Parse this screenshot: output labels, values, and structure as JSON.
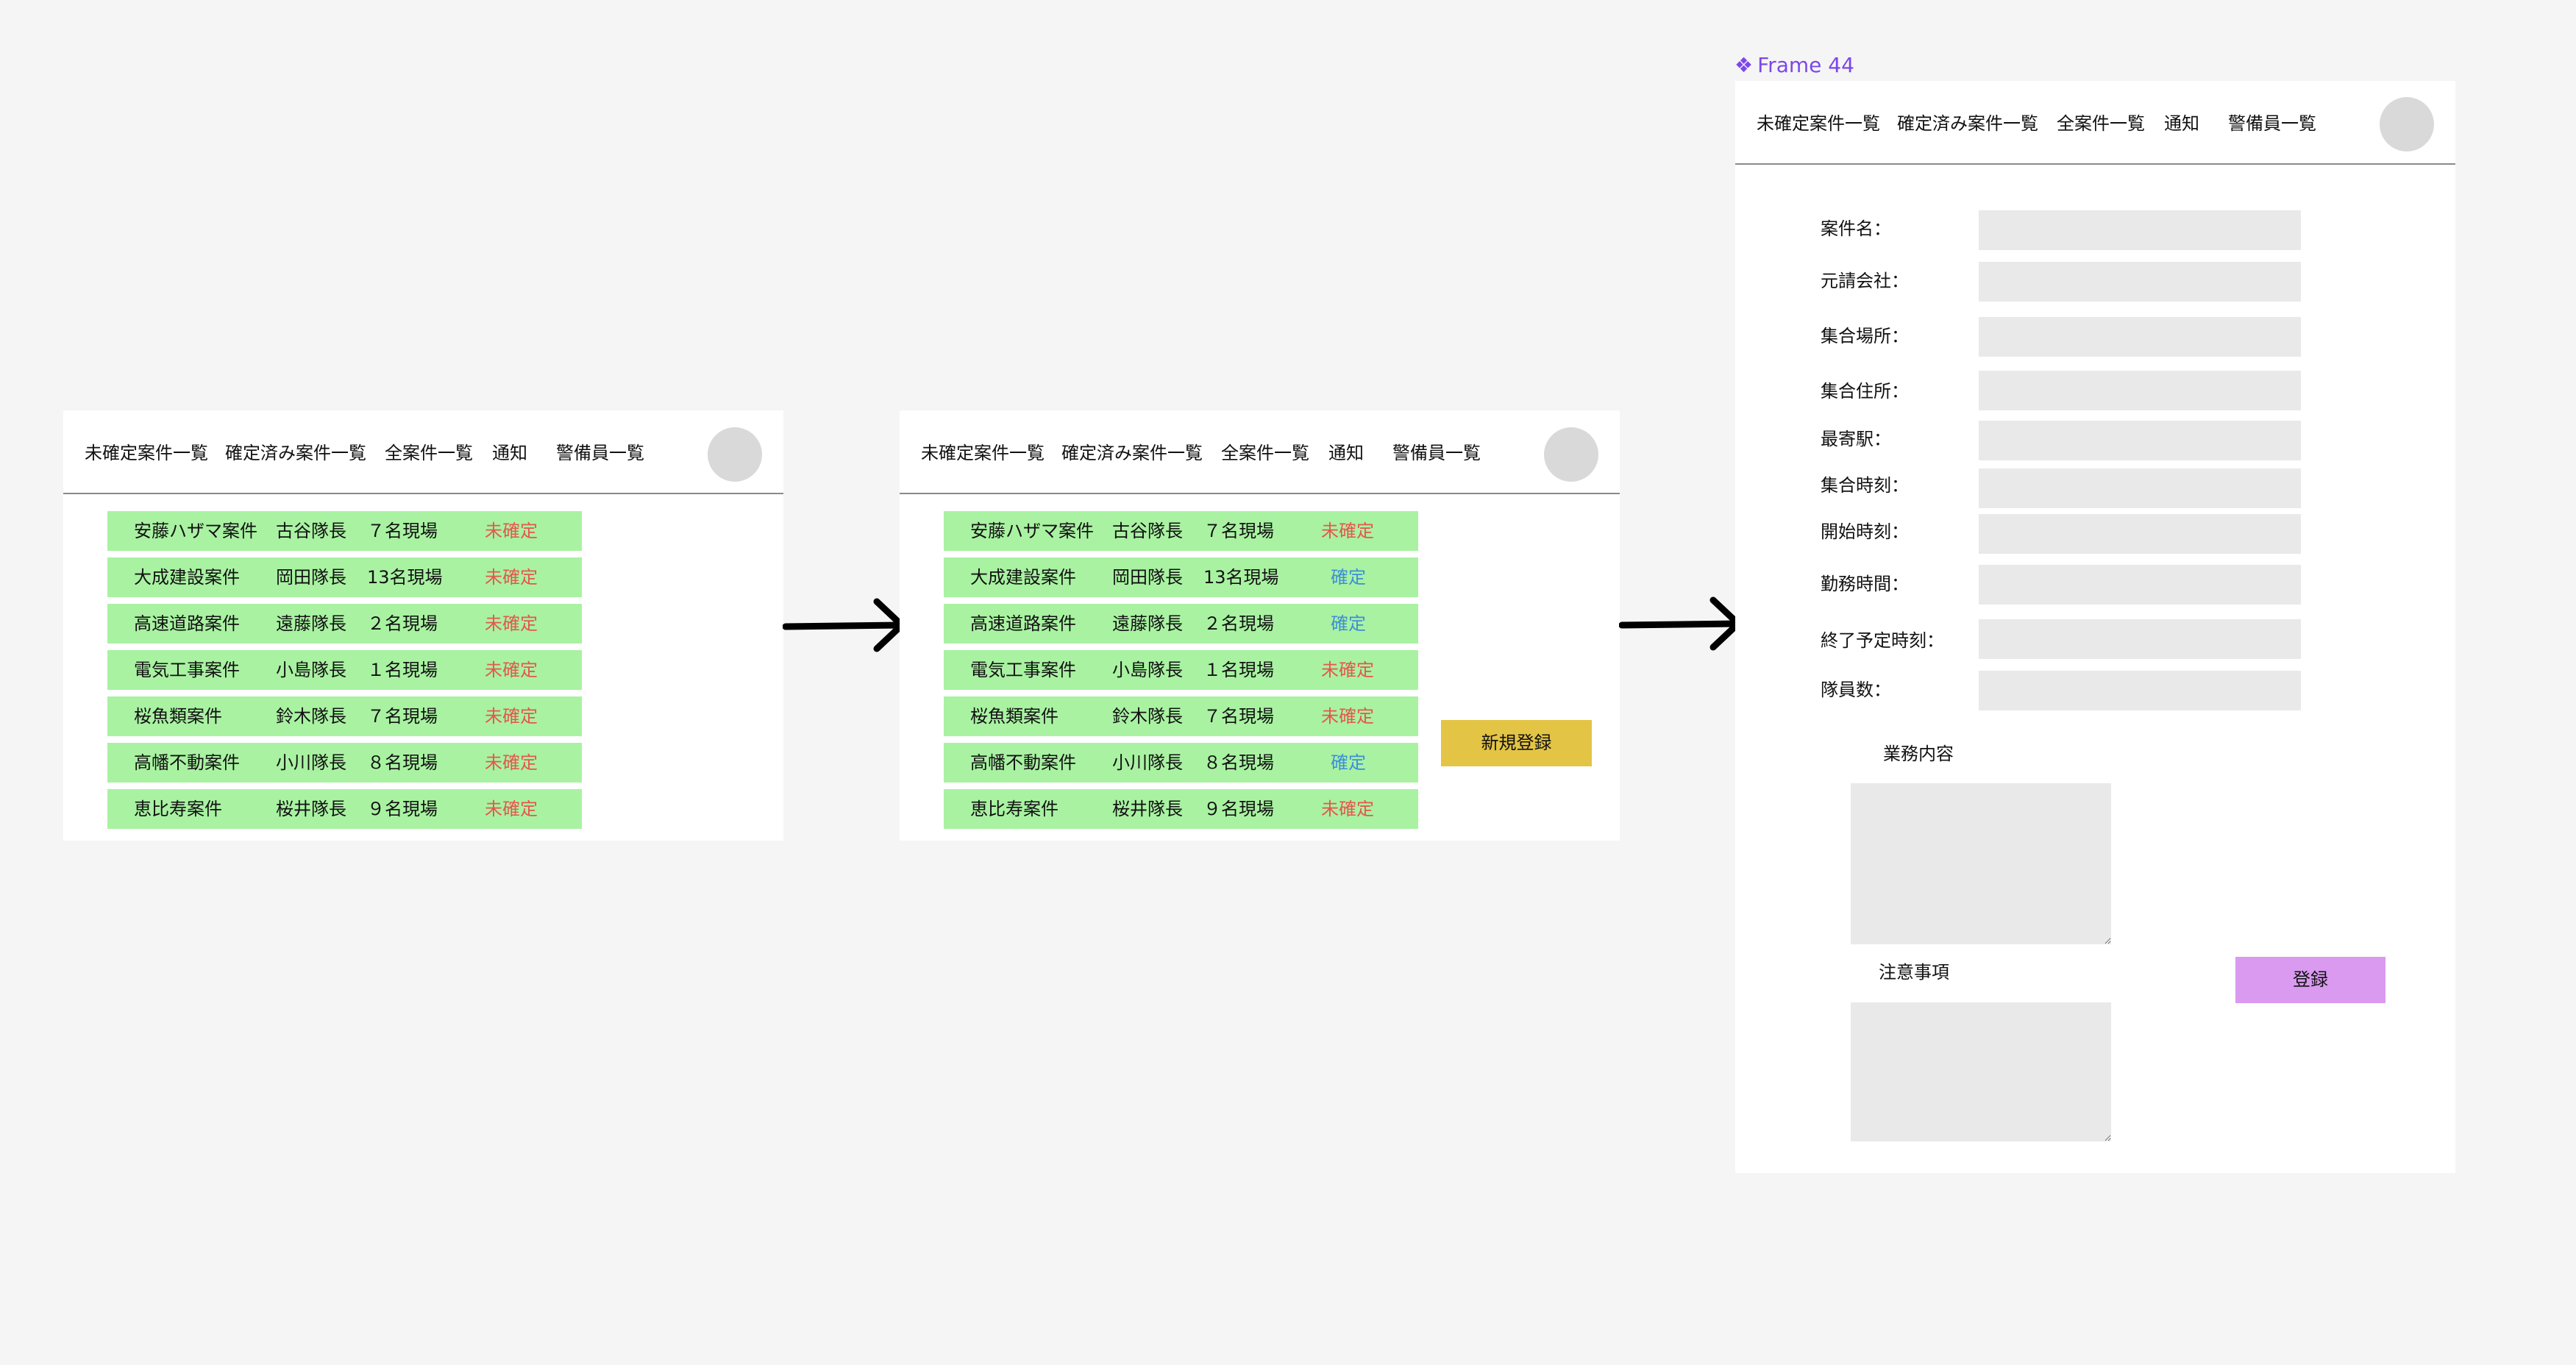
{
  "nav": {
    "unconfirmed": "未確定案件一覧",
    "confirmed": "確定済み案件一覧",
    "all": "全案件一覧",
    "notify": "通知",
    "guards": "警備員一覧"
  },
  "screen1": {
    "rows": [
      {
        "name": "安藤ハザマ案件",
        "leader": "古谷隊長",
        "count": "７名現場",
        "status": "未確定"
      },
      {
        "name": "大成建設案件",
        "leader": "岡田隊長",
        "count": "13名現場",
        "status": "未確定"
      },
      {
        "name": "高速道路案件",
        "leader": "遠藤隊長",
        "count": "２名現場",
        "status": "未確定"
      },
      {
        "name": "電気工事案件",
        "leader": "小島隊長",
        "count": "１名現場",
        "status": "未確定"
      },
      {
        "name": "桜魚類案件",
        "leader": "鈴木隊長",
        "count": "７名現場",
        "status": "未確定"
      },
      {
        "name": "高幡不動案件",
        "leader": "小川隊長",
        "count": "８名現場",
        "status": "未確定"
      },
      {
        "name": "恵比寿案件",
        "leader": "桜井隊長",
        "count": "９名現場",
        "status": "未確定"
      }
    ]
  },
  "screen2": {
    "rows": [
      {
        "name": "安藤ハザマ案件",
        "leader": "古谷隊長",
        "count": "７名現場",
        "status": "未確定"
      },
      {
        "name": "大成建設案件",
        "leader": "岡田隊長",
        "count": "13名現場",
        "status": "確定"
      },
      {
        "name": "高速道路案件",
        "leader": "遠藤隊長",
        "count": "２名現場",
        "status": "確定"
      },
      {
        "name": "電気工事案件",
        "leader": "小島隊長",
        "count": "１名現場",
        "status": "未確定"
      },
      {
        "name": "桜魚類案件",
        "leader": "鈴木隊長",
        "count": "７名現場",
        "status": "未確定"
      },
      {
        "name": "高幡不動案件",
        "leader": "小川隊長",
        "count": "８名現場",
        "status": "確定"
      },
      {
        "name": "恵比寿案件",
        "leader": "桜井隊長",
        "count": "９名現場",
        "status": "未確定"
      }
    ],
    "new_button": "新規登録"
  },
  "frame_label": {
    "icon": "❖",
    "text": "Frame 44"
  },
  "form": {
    "fields": [
      {
        "label": "案件名：",
        "value": ""
      },
      {
        "label": "元請会社：",
        "value": ""
      },
      {
        "label": "集合場所：",
        "value": ""
      },
      {
        "label": "集合住所：",
        "value": ""
      },
      {
        "label": "最寄駅：",
        "value": ""
      },
      {
        "label": "集合時刻：",
        "value": ""
      },
      {
        "label": "開始時刻：",
        "value": ""
      },
      {
        "label": "勤務時間：",
        "value": ""
      },
      {
        "label": "終了予定時刻：",
        "value": ""
      },
      {
        "label": "隊員数：",
        "value": ""
      }
    ],
    "work_label": "業務内容",
    "notes_label": "注意事項",
    "register_button": "登録"
  },
  "colors": {
    "row_bg": "#a9f2a2",
    "unconfirmed": "#e5574f",
    "confirmed": "#3d8fd8",
    "new_button": "#e3c445",
    "register_button": "#d99af0",
    "frame_label": "#7b48e8"
  }
}
